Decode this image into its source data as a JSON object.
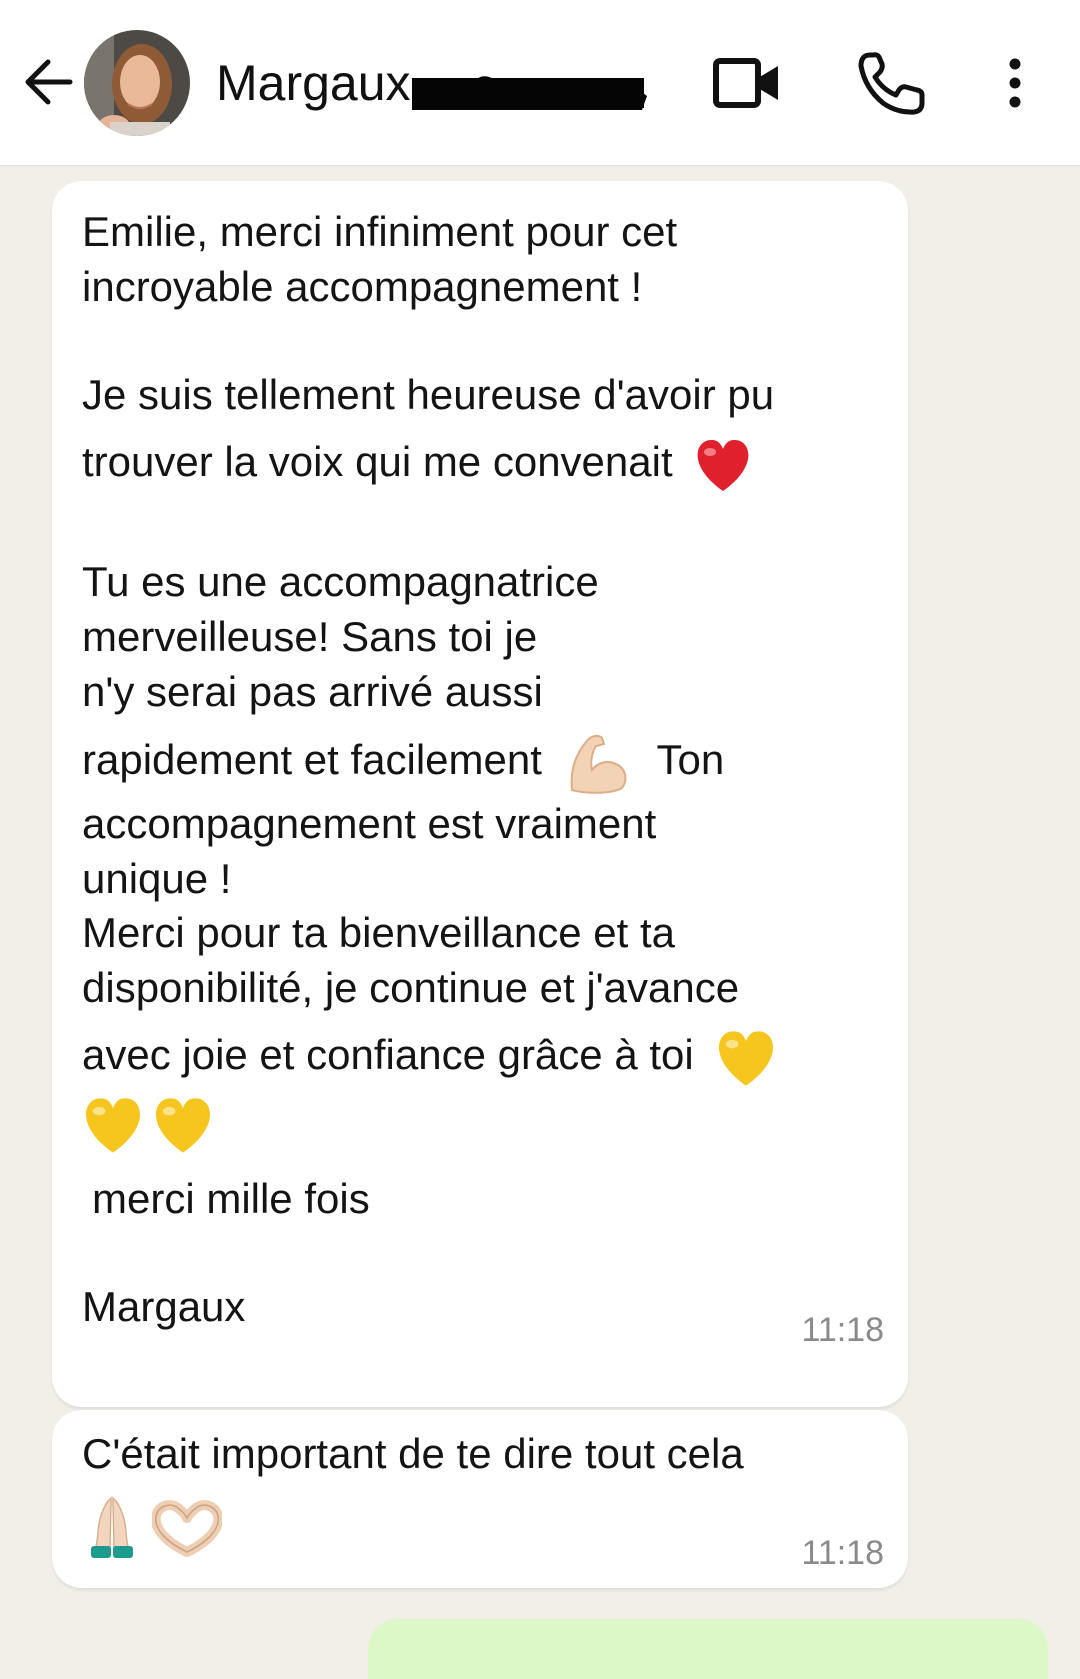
{
  "header": {
    "contact_name": "Margaux",
    "icons": [
      "back-arrow-icon",
      "video-call-icon",
      "phone-icon",
      "more-vert-icon"
    ]
  },
  "messages": [
    {
      "lines": [
        "Emilie, merci infiniment pour cet",
        "incroyable accompagnement !",
        "Je suis tellement heureuse d'avoir pu",
        "trouver la voix qui me convenait",
        "Tu es une accompagnatrice",
        "merveilleuse!  Sans toi je",
        "n'y serai pas arrivé aussi",
        "rapidement et facilement",
        "Ton",
        "accompagnement est vraiment",
        "unique !",
        "Merci pour ta bienveillance et ta",
        "disponibilité, je continue et j'avance",
        "avec joie et confiance grâce à toi",
        "merci mille fois",
        "Margaux"
      ],
      "time": "11:18"
    },
    {
      "lines": [
        "C'était important de te dire tout cela"
      ],
      "time": "11:18"
    }
  ],
  "colors": {
    "chat_background": "#f1efe8",
    "bubble": "#ffffff",
    "outgoing_bubble": "#dcf8c6",
    "heart_red": "#e0202c",
    "heart_yellow": "#f6c51e"
  }
}
